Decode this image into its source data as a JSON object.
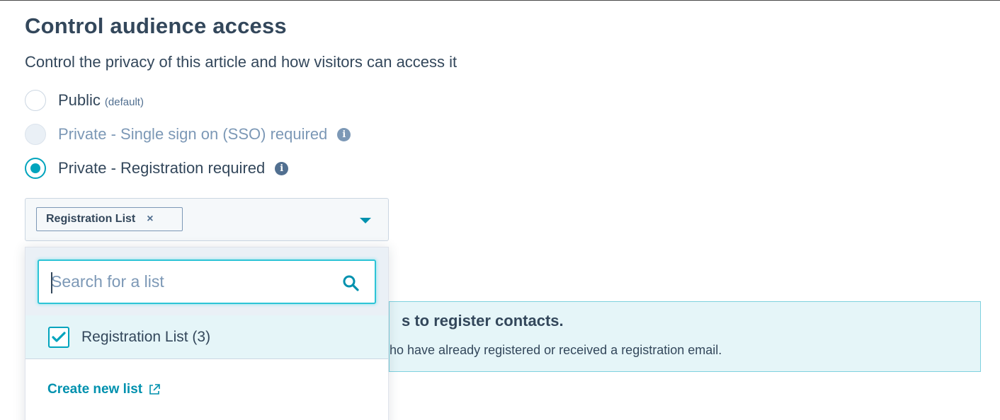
{
  "header": {
    "title": "Control audience access",
    "subtitle": "Control the privacy of this article and how visitors can access it"
  },
  "access_options": [
    {
      "label": "Public",
      "note": "(default)",
      "state": "unchecked"
    },
    {
      "label": "Private - Single sign on (SSO) required",
      "state": "disabled"
    },
    {
      "label": "Private - Registration required",
      "state": "checked"
    }
  ],
  "list_select": {
    "selected_tag": "Registration List",
    "remove_glyph": "×"
  },
  "dropdown": {
    "search_placeholder": "Search for a list",
    "search_value": "",
    "options": [
      {
        "label": "Registration List (3)",
        "checked": true
      }
    ],
    "create_link": "Create new list"
  },
  "banner": {
    "title": "s to register contacts.",
    "text": "ho have already registered or received a registration email."
  },
  "icons": {
    "info": "info-icon",
    "search": "search-icon",
    "external": "external-link-icon",
    "caret": "caret-down-icon",
    "check": "checkmark-icon"
  },
  "colors": {
    "accent": "#00a4bd",
    "link": "#0091ae",
    "text": "#33475b",
    "banner_bg": "#e5f5f8"
  }
}
